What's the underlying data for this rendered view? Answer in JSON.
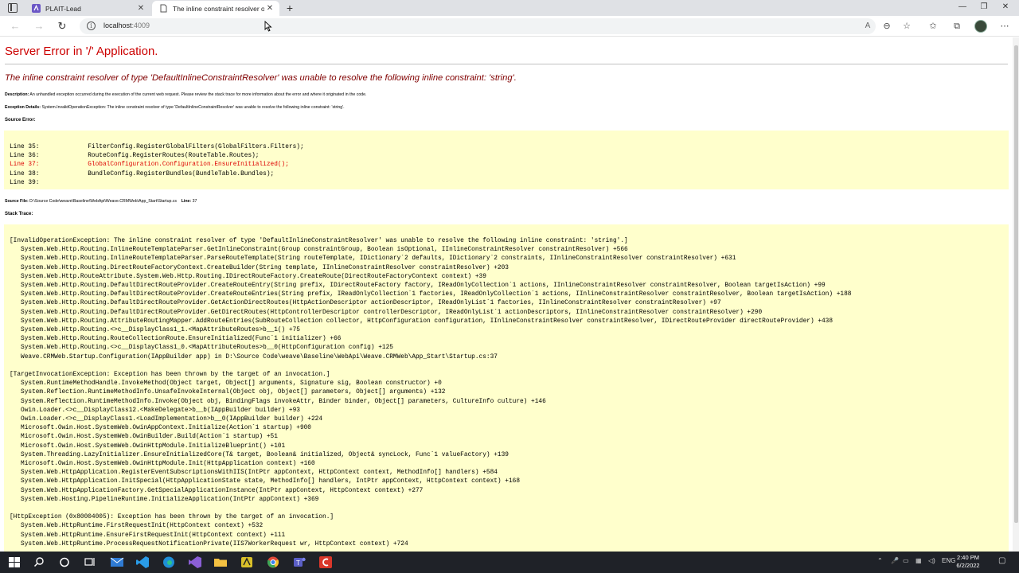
{
  "browser": {
    "tabs": [
      {
        "title": "PLAIT-Lead"
      },
      {
        "title": "The inline constraint resolver of"
      }
    ],
    "url_host": "localhost",
    "url_port": ":4009"
  },
  "page": {
    "heading": "Server Error in '/' Application.",
    "subheading": "The inline constraint resolver of type 'DefaultInlineConstraintResolver' was unable to resolve the following inline constraint: 'string'.",
    "description_label": "Description:",
    "description_text": "An unhandled exception occurred during the execution of the current web request. Please review the stack trace for more information about the error and where it originated in the code.",
    "exception_label": "Exception Details:",
    "exception_text": "System.InvalidOperationException: The inline constraint resolver of type 'DefaultInlineConstraintResolver' was unable to resolve the following inline constraint: 'string'.",
    "source_error_label": "Source Error:",
    "source_lines": [
      {
        "text": "Line 35:             FilterConfig.RegisterGlobalFilters(GlobalFilters.Filters);",
        "error": false
      },
      {
        "text": "Line 36:             RouteConfig.RegisterRoutes(RouteTable.Routes);",
        "error": false
      },
      {
        "text": "Line 37:             GlobalConfiguration.Configuration.EnsureInitialized();",
        "error": true
      },
      {
        "text": "Line 38:             BundleConfig.RegisterBundles(BundleTable.Bundles);",
        "error": false
      },
      {
        "text": "Line 39:",
        "error": false
      }
    ],
    "source_file_label": "Source File:",
    "source_file_path": "D:\\Source Code\\weave\\Baseline\\WebApi\\Weave.CRMWeb\\App_Start\\Startup.cs",
    "line_label": "Line:",
    "line_number": "37",
    "stack_trace_label": "Stack Trace:",
    "stack_lines": [
      "[InvalidOperationException: The inline constraint resolver of type 'DefaultInlineConstraintResolver' was unable to resolve the following inline constraint: 'string'.]",
      "   System.Web.Http.Routing.InlineRouteTemplateParser.GetInlineConstraint(Group constraintGroup, Boolean isOptional, IInlineConstraintResolver constraintResolver) +566",
      "   System.Web.Http.Routing.InlineRouteTemplateParser.ParseRouteTemplate(String routeTemplate, IDictionary`2 defaults, IDictionary`2 constraints, IInlineConstraintResolver constraintResolver) +631",
      "   System.Web.Http.Routing.DirectRouteFactoryContext.CreateBuilder(String template, IInlineConstraintResolver constraintResolver) +203",
      "   System.Web.Http.RouteAttribute.System.Web.Http.Routing.IDirectRouteFactory.CreateRoute(DirectRouteFactoryContext context) +39",
      "   System.Web.Http.Routing.DefaultDirectRouteProvider.CreateRouteEntry(String prefix, IDirectRouteFactory factory, IReadOnlyCollection`1 actions, IInlineConstraintResolver constraintResolver, Boolean targetIsAction) +99",
      "   System.Web.Http.Routing.DefaultDirectRouteProvider.CreateRouteEntries(String prefix, IReadOnlyCollection`1 factories, IReadOnlyCollection`1 actions, IInlineConstraintResolver constraintResolver, Boolean targetIsAction) +188",
      "   System.Web.Http.Routing.DefaultDirectRouteProvider.GetActionDirectRoutes(HttpActionDescriptor actionDescriptor, IReadOnlyList`1 factories, IInlineConstraintResolver constraintResolver) +97",
      "   System.Web.Http.Routing.DefaultDirectRouteProvider.GetDirectRoutes(HttpControllerDescriptor controllerDescriptor, IReadOnlyList`1 actionDescriptors, IInlineConstraintResolver constraintResolver) +290",
      "   System.Web.Http.Routing.AttributeRoutingMapper.AddRouteEntries(SubRouteCollection collector, HttpConfiguration configuration, IInlineConstraintResolver constraintResolver, IDirectRouteProvider directRouteProvider) +438",
      "   System.Web.Http.Routing.<>c__DisplayClass1_1.<MapAttributeRoutes>b__1() +75",
      "   System.Web.Http.Routing.RouteCollectionRoute.EnsureInitialized(Func`1 initializer) +66",
      "   System.Web.Http.Routing.<>c__DisplayClass1_0.<MapAttributeRoutes>b__0(HttpConfiguration config) +125",
      "   Weave.CRMWeb.Startup.Configuration(IAppBuilder app) in D:\\Source Code\\weave\\Baseline\\WebApi\\Weave.CRMWeb\\App_Start\\Startup.cs:37",
      "",
      "[TargetInvocationException: Exception has been thrown by the target of an invocation.]",
      "   System.RuntimeMethodHandle.InvokeMethod(Object target, Object[] arguments, Signature sig, Boolean constructor) +0",
      "   System.Reflection.RuntimeMethodInfo.UnsafeInvokeInternal(Object obj, Object[] parameters, Object[] arguments) +132",
      "   System.Reflection.RuntimeMethodInfo.Invoke(Object obj, BindingFlags invokeAttr, Binder binder, Object[] parameters, CultureInfo culture) +146",
      "   Owin.Loader.<>c__DisplayClass12.<MakeDelegate>b__b(IAppBuilder builder) +93",
      "   Owin.Loader.<>c__DisplayClass1.<LoadImplementation>b__0(IAppBuilder builder) +224",
      "   Microsoft.Owin.Host.SystemWeb.OwinAppContext.Initialize(Action`1 startup) +900",
      "   Microsoft.Owin.Host.SystemWeb.OwinBuilder.Build(Action`1 startup) +51",
      "   Microsoft.Owin.Host.SystemWeb.OwinHttpModule.InitializeBlueprint() +101",
      "   System.Threading.LazyInitializer.EnsureInitializedCore(T& target, Boolean& initialized, Object& syncLock, Func`1 valueFactory) +139",
      "   Microsoft.Owin.Host.SystemWeb.OwinHttpModule.Init(HttpApplication context) +160",
      "   System.Web.HttpApplication.RegisterEventSubscriptionsWithIIS(IntPtr appContext, HttpContext context, MethodInfo[] handlers) +584",
      "   System.Web.HttpApplication.InitSpecial(HttpApplicationState state, MethodInfo[] handlers, IntPtr appContext, HttpContext context) +168",
      "   System.Web.HttpApplicationFactory.GetSpecialApplicationInstance(IntPtr appContext, HttpContext context) +277",
      "   System.Web.Hosting.PipelineRuntime.InitializeApplication(IntPtr appContext) +369",
      "",
      "[HttpException (0x80004005): Exception has been thrown by the target of an invocation.]",
      "   System.Web.HttpRuntime.FirstRequestInit(HttpContext context) +532",
      "   System.Web.HttpRuntime.EnsureFirstRequestInit(HttpContext context) +111",
      "   System.Web.HttpRuntime.ProcessRequestNotificationPrivate(IIS7WorkerRequest wr, HttpContext context) +724"
    ]
  },
  "taskbar": {
    "language": "ENG",
    "time": "2:40 PM",
    "date": "6/2/2022"
  }
}
